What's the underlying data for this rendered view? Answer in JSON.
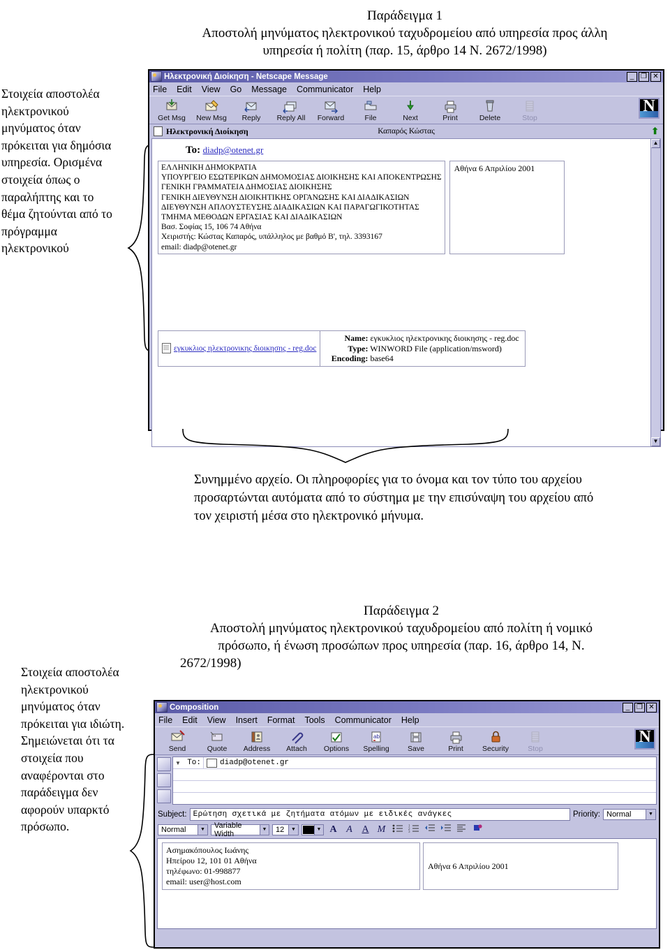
{
  "example1": {
    "heading": "Παράδειγμα 1",
    "subheading_line1": "Αποστολή μηνύματος ηλεκτρονικού ταχυδρομείου από υπηρεσία προς άλλη",
    "subheading_line2": "υπηρεσία ή πολίτη (παρ. 15, άρθρο 14 Ν. 2672/1998)",
    "note": "Στοιχεία αποστολέα ηλεκτρονικού μηνύματος όταν πρόκειται για δημόσια υπηρεσία. Ορισμένα στοιχεία όπως ο παραλήπτης και το θέμα ζητούνται από το πρόγραμμα ηλεκτρονικού",
    "window": {
      "title": "Ηλεκτρονική Διοίκηση - Netscape Message",
      "buttons": {
        "minimize": "_",
        "restore": "❐",
        "close": "✕"
      },
      "menus": [
        "File",
        "Edit",
        "View",
        "Go",
        "Message",
        "Communicator",
        "Help"
      ],
      "toolbar": [
        "Get Msg",
        "New Msg",
        "Reply",
        "Reply All",
        "Forward",
        "File",
        "Next",
        "Print",
        "Delete",
        "Stop"
      ],
      "strip": {
        "folder": "Ηλεκτρονική Διοίκηση",
        "sender": "Καπαρός Κώστας"
      },
      "to_label": "To:",
      "to_value": "diadp@otenet.gr",
      "letterhead": [
        "ΕΛΛΗΝΙΚΗ ΔΗΜΟΚΡΑΤΙΑ",
        "ΥΠΟΥΡΓΕΙΟ ΕΣΩΤΕΡΙΚΩΝ ΔΗΜΟΜΟΣΙΑΣ ΔΙΟΙΚΗΣΗΣ ΚΑΙ ΑΠΟΚΕΝΤΡΩΣΗΣ",
        "ΓΕΝΙΚΗ ΓΡΑΜΜΑΤΕΙΑ ΔΗΜΟΣΙΑΣ ΔΙΟΙΚΗΣΗΣ",
        "ΓΕΝΙΚΗ ΔΙΕΥΘΥΝΣΗ ΔΙΟΙΚΗΤΙΚΗΣ ΟΡΓΑΝΩΣΗΣ ΚΑΙ ΔΙΑΔΙΚΑΣΙΩΝ",
        "ΔΙΕΥΘΥΝΣΗ ΑΠΛΟΥΣΤΕΥΣΗΣ ΔΙΑΔΙΚΑΣΙΩΝ ΚΑΙ ΠΑΡΑΓΩΓΙΚΟΤΗΤΑΣ",
        "ΤΜΗΜΑ ΜΕΘΟΔΩΝ ΕΡΓΑΣΙΑΣ ΚΑΙ ΔΙΑΔΙΚΑΣΙΩΝ",
        "Βασ. Σοφίας 15, 106 74 Αθήνα",
        "Χειριστής: Κώστας Καπαρός, υπάλληλος με βαθμό Β', τηλ. 3393167",
        "email: diadp@otenet.gr"
      ],
      "date_box": "Αθήνα 6 Απριλίου 2001",
      "attachment": {
        "link": "εγκυκλιος ηλεκτρονικης διοικησης - reg.doc",
        "name_label": "Name:",
        "name_value": "εγκυκλιος ηλεκτρονικης διοικησης - reg.doc",
        "type_label": "Type:",
        "type_value": "WINWORD File (application/msword)",
        "encoding_label": "Encoding:",
        "encoding_value": "base64"
      }
    }
  },
  "middle_paragraph": "Συνημμένο αρχείο. Οι πληροφορίες για το όνομα και τον τύπο του αρχείου προσαρτώνται αυτόματα από το σύστημα με την επισύναψη του αρχείου από τον χειριστή μέσα στο ηλεκτρονικό μήνυμα.",
  "example2": {
    "heading": "Παράδειγμα 2",
    "subheading_line1": "Αποστολή μηνύματος ηλεκτρονικού ταχυδρομείου από πολίτη ή νομικό",
    "subheading_line2": "πρόσωπο, ή ένωση προσώπων προς υπηρεσία (παρ. 16, άρθρο 14, Ν.",
    "subheading_line3": "2672/1998)",
    "note": "Στοιχεία αποστολέα ηλεκτρονικού μηνύματος όταν πρόκειται για ιδιώτη. Σημειώνεται ότι τα στοιχεία που αναφέρονται στο παράδειγμα δεν αφορούν υπαρκτό πρόσωπο.",
    "window": {
      "title": "Composition",
      "buttons": {
        "minimize": "_",
        "restore": "❐",
        "close": "✕"
      },
      "menus": [
        "File",
        "Edit",
        "View",
        "Insert",
        "Format",
        "Tools",
        "Communicator",
        "Help"
      ],
      "toolbar": [
        "Send",
        "Quote",
        "Address",
        "Attach",
        "Options",
        "Spelling",
        "Save",
        "Print",
        "Security",
        "Stop"
      ],
      "to_label": "To:",
      "to_value": "diadp@otenet.gr",
      "subject_label": "Subject:",
      "subject_value": "Ερώτηση σχετικά με ζητήματα ατόμων με ειδικές ανάγκες",
      "priority_label": "Priority:",
      "priority_value": "Normal",
      "format_style": "Normal",
      "format_font": "Variable Width",
      "format_size": "12",
      "format_color": "#000000",
      "sender_lines": [
        "Ασημακόπουλος Ιωάνης",
        "Ηπείρου 12, 101 01 Αθήνα",
        "τηλέφωνο: 01-998877",
        "email: user@host.com"
      ],
      "date_box": "Αθήνα 6 Απριλίου 2001"
    }
  },
  "theme": {
    "chrome": "#c3c3e0",
    "titlebar": "#6f6fb5",
    "link": "#2b2bc0",
    "border": "#7a7aa8"
  }
}
